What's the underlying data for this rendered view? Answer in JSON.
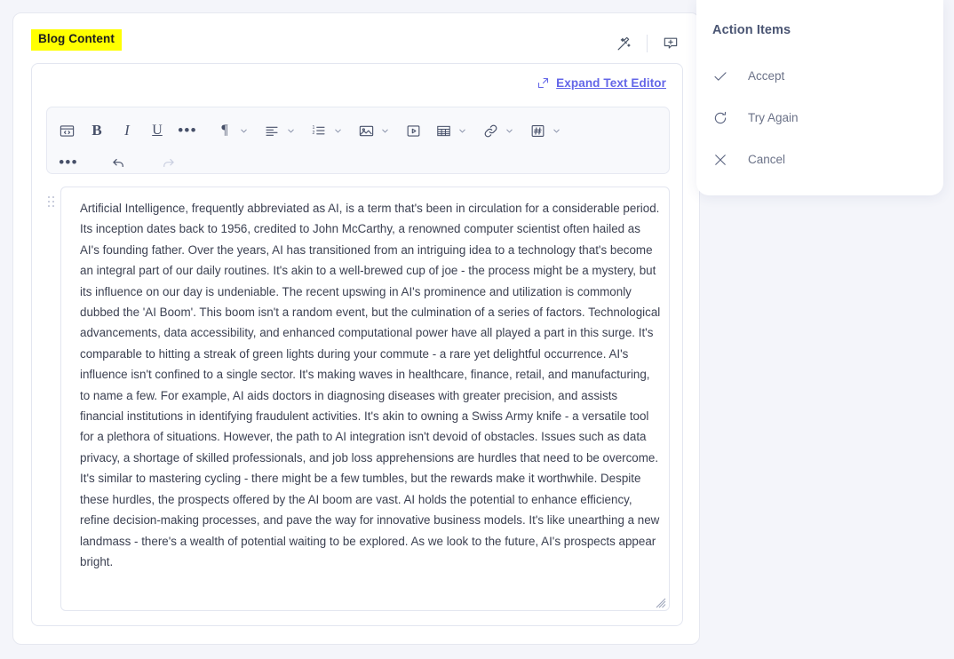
{
  "colors": {
    "page_background": "#f4f5fa",
    "card_background": "#ffffff",
    "highlight_yellow": "#ffff00",
    "link_purple": "#6366e8",
    "toolbar_background": "#f8f9fc",
    "body_text": "#3c4152",
    "panel_title": "#4a5573"
  },
  "card": {
    "label": "Blog Content",
    "header_icons": [
      {
        "name": "magic-wand-icon",
        "title": "AI Assist"
      },
      {
        "name": "add-comment-icon",
        "title": "Add Comment"
      }
    ]
  },
  "editor": {
    "expand_link": "Expand Text Editor",
    "expand_icon": "expand-arrow-icon",
    "toolbar": {
      "row1": [
        {
          "name": "code-block-icon",
          "label": "code",
          "chevron": false
        },
        {
          "name": "bold-icon",
          "label": "B",
          "chevron": false
        },
        {
          "name": "italic-icon",
          "label": "I",
          "chevron": false
        },
        {
          "name": "underline-icon",
          "label": "U",
          "chevron": false
        },
        {
          "name": "more-formats-icon",
          "label": "•••",
          "chevron": false
        },
        {
          "name": "paragraph-style-icon",
          "label": "¶",
          "chevron": true
        },
        {
          "name": "text-align-icon",
          "label": "align",
          "chevron": true
        },
        {
          "name": "numbered-list-icon",
          "label": "list",
          "chevron": true
        },
        {
          "name": "insert-image-icon",
          "label": "image",
          "chevron": true
        },
        {
          "name": "insert-video-icon",
          "label": "video",
          "chevron": false
        },
        {
          "name": "insert-table-icon",
          "label": "table",
          "chevron": true
        },
        {
          "name": "insert-link-icon",
          "label": "link",
          "chevron": true
        },
        {
          "name": "insert-token-icon",
          "label": "#",
          "chevron": true
        }
      ],
      "row2": [
        {
          "name": "more-options-icon",
          "label": "•••",
          "disabled": false
        },
        {
          "name": "undo-icon",
          "label": "undo",
          "disabled": false
        },
        {
          "name": "redo-icon",
          "label": "redo",
          "disabled": true
        }
      ]
    },
    "body_text": "Artificial Intelligence, frequently abbreviated as AI, is a term that's been in circulation for a considerable period. Its inception dates back to 1956, credited to John McCarthy, a renowned computer scientist often hailed as AI's founding father. Over the years, AI has transitioned from an intriguing idea to a technology that's become an integral part of our daily routines. It's akin to a well-brewed cup of joe - the process might be a mystery, but its influence on our day is undeniable. The recent upswing in AI's prominence and utilization is commonly dubbed the 'AI Boom'. This boom isn't a random event, but the culmination of a series of factors. Technological advancements, data accessibility, and enhanced computational power have all played a part in this surge. It's comparable to hitting a streak of green lights during your commute - a rare yet delightful occurrence. AI's influence isn't confined to a single sector. It's making waves in healthcare, finance, retail, and manufacturing, to name a few. For example, AI aids doctors in diagnosing diseases with greater precision, and assists financial institutions in identifying fraudulent activities. It's akin to owning a Swiss Army knife - a versatile tool for a plethora of situations. However, the path to AI integration isn't devoid of obstacles. Issues such as data privacy, a shortage of skilled professionals, and job loss apprehensions are hurdles that need to be overcome. It's similar to mastering cycling - there might be a few tumbles, but the rewards make it worthwhile. Despite these hurdles, the prospects offered by the AI boom are vast. AI holds the potential to enhance efficiency, refine decision-making processes, and pave the way for innovative business models. It's like unearthing a new landmass - there's a wealth of potential waiting to be explored. As we look to the future, AI's prospects appear bright."
  },
  "action_panel": {
    "title": "Action Items",
    "items": [
      {
        "label": "Accept",
        "icon": "check-icon"
      },
      {
        "label": "Try Again",
        "icon": "refresh-icon"
      },
      {
        "label": "Cancel",
        "icon": "close-icon"
      }
    ]
  }
}
